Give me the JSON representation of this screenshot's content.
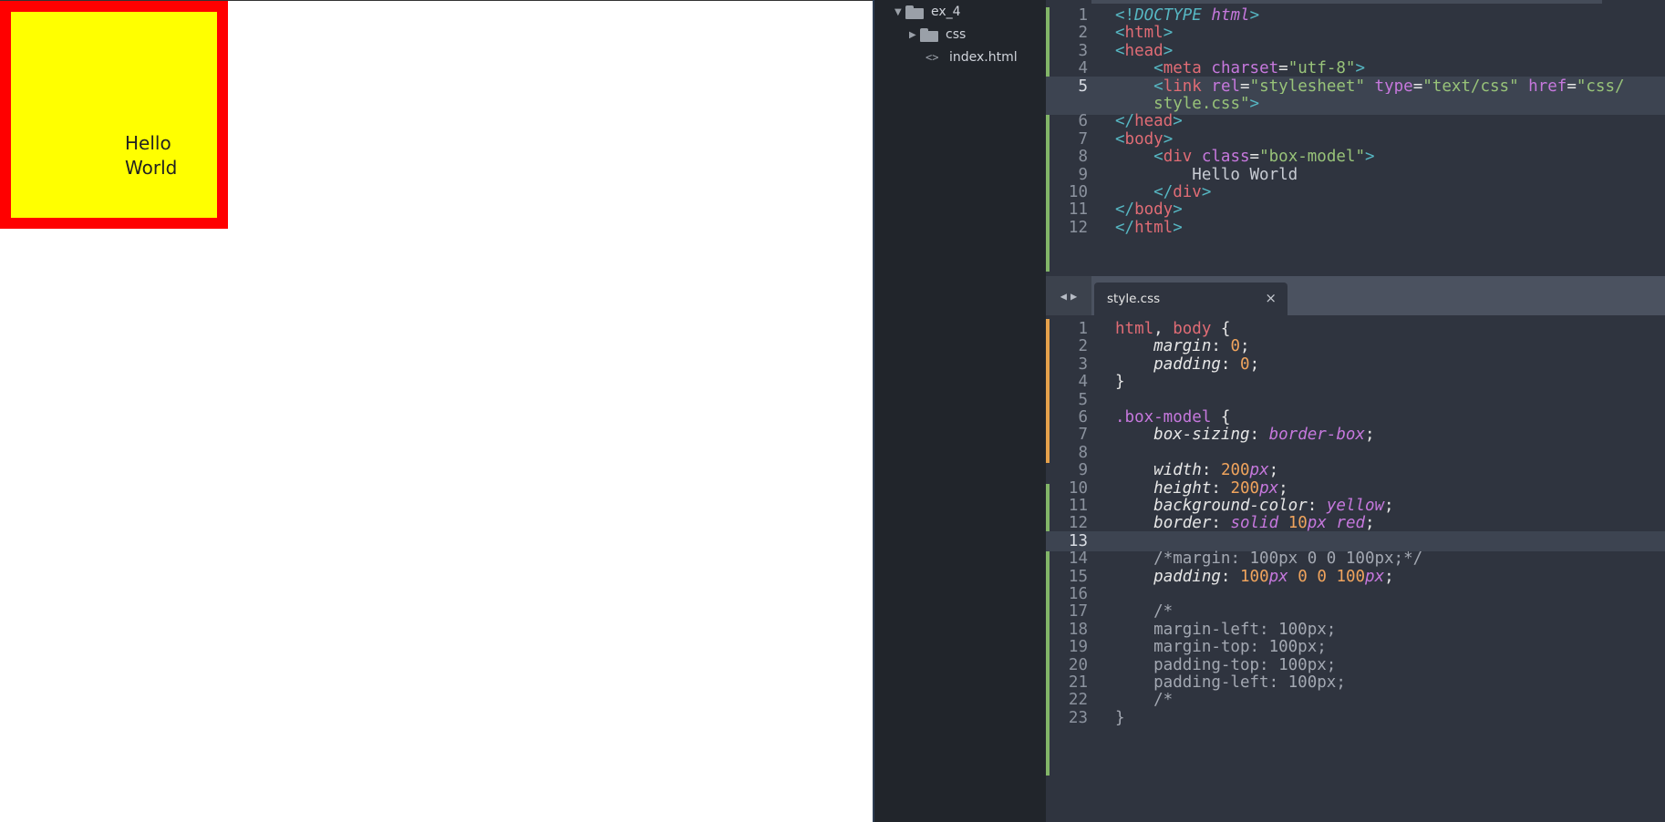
{
  "preview": {
    "box_text": "Hello World"
  },
  "sidebar": {
    "items": [
      {
        "label": "ex_4",
        "type": "folder",
        "expanded": true
      },
      {
        "label": "css",
        "type": "folder",
        "expanded": false
      },
      {
        "label": "index.html",
        "type": "file"
      }
    ]
  },
  "tabs": [
    {
      "label": "style.css",
      "close": "×"
    }
  ],
  "html_file": {
    "lines": [
      {
        "num": "1",
        "text": "<!DOCTYPE html>"
      },
      {
        "num": "2",
        "text": "<html>"
      },
      {
        "num": "3",
        "text": "<head>"
      },
      {
        "num": "4",
        "text": "    <meta charset=\"utf-8\">"
      },
      {
        "num": "5",
        "text": "    <link rel=\"stylesheet\" type=\"text/css\" href=\"css/"
      },
      {
        "num": "",
        "text": "    style.css\">"
      },
      {
        "num": "6",
        "text": "</head>"
      },
      {
        "num": "7",
        "text": "<body>"
      },
      {
        "num": "8",
        "text": "    <div class=\"box-model\">"
      },
      {
        "num": "9",
        "text": "        Hello World"
      },
      {
        "num": "10",
        "text": "    </div>"
      },
      {
        "num": "11",
        "text": "</body>"
      },
      {
        "num": "12",
        "text": "</html>"
      }
    ]
  },
  "css_file": {
    "lines": [
      {
        "num": "1",
        "text": "html, body {"
      },
      {
        "num": "2",
        "text": "    margin: 0;"
      },
      {
        "num": "3",
        "text": "    padding: 0;"
      },
      {
        "num": "4",
        "text": "}"
      },
      {
        "num": "5",
        "text": ""
      },
      {
        "num": "6",
        "text": ".box-model {"
      },
      {
        "num": "7",
        "text": "    box-sizing: border-box;"
      },
      {
        "num": "8",
        "text": ""
      },
      {
        "num": "9",
        "text": "    width: 200px;"
      },
      {
        "num": "10",
        "text": "    height: 200px;"
      },
      {
        "num": "11",
        "text": "    background-color: yellow;"
      },
      {
        "num": "12",
        "text": "    border: solid 10px red;"
      },
      {
        "num": "13",
        "text": ""
      },
      {
        "num": "14",
        "text": "    /*margin: 100px 0 0 100px;*/"
      },
      {
        "num": "15",
        "text": "    padding: 100px 0 0 100px;"
      },
      {
        "num": "16",
        "text": ""
      },
      {
        "num": "17",
        "text": "    /*"
      },
      {
        "num": "18",
        "text": "    margin-left: 100px;"
      },
      {
        "num": "19",
        "text": "    margin-top: 100px;"
      },
      {
        "num": "20",
        "text": "    padding-top: 100px;"
      },
      {
        "num": "21",
        "text": "    padding-left: 100px;"
      },
      {
        "num": "22",
        "text": "    /*"
      },
      {
        "num": "23",
        "text": "}"
      }
    ]
  },
  "colors": {
    "box_background": "#ffff00",
    "box_border": "#ff0000",
    "editor_background": "#2f343f",
    "sidebar_background": "#21252b",
    "git_modified": "#e5a14b",
    "git_added": "#82b568"
  }
}
